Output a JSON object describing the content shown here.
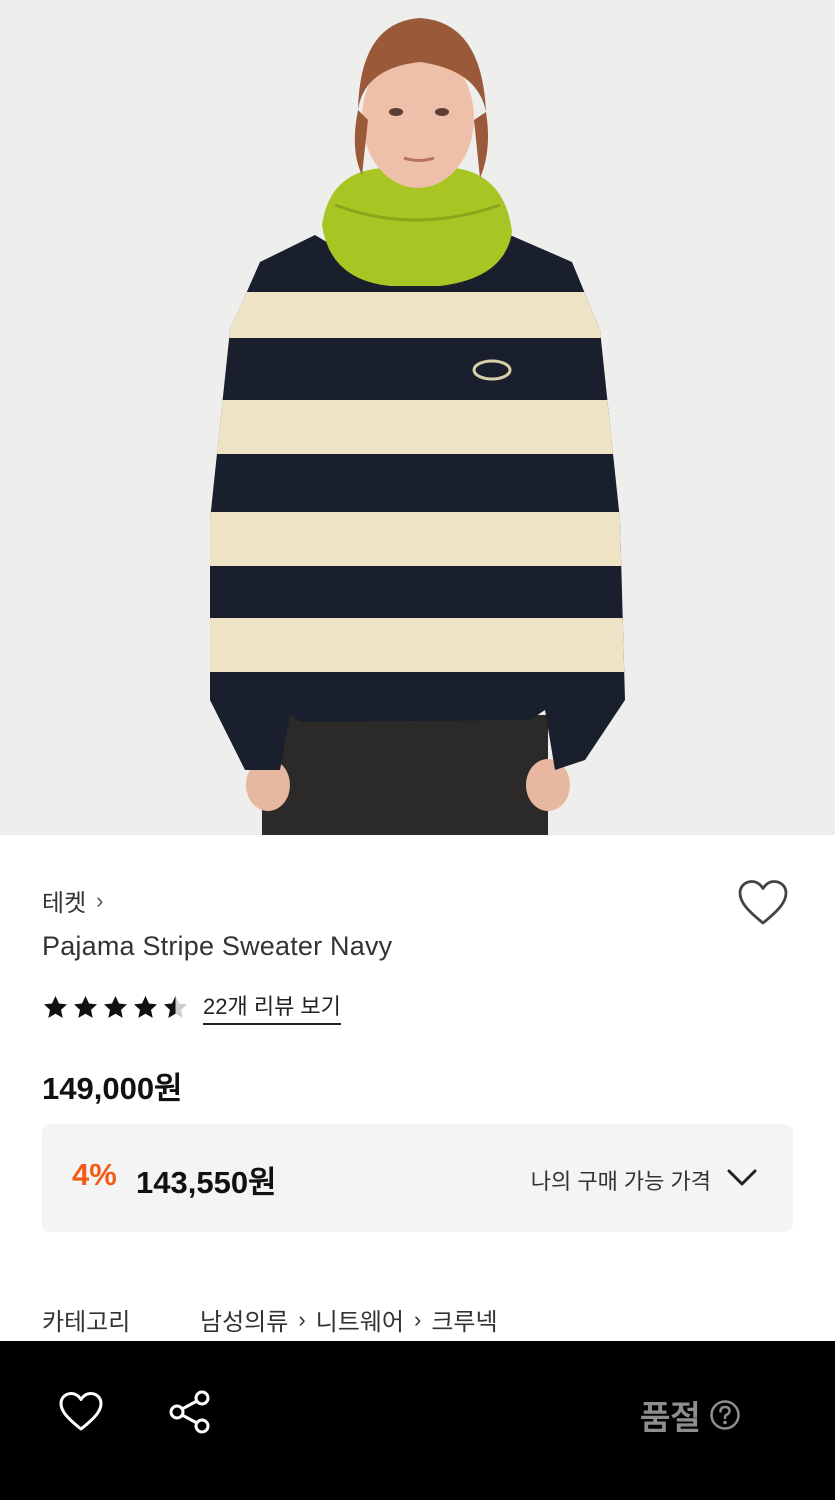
{
  "product": {
    "image_alt": "Model wearing striped sweater with green neck warmer",
    "brand": "테켓",
    "brand_chevron": "›",
    "name": "Pajama Stripe Sweater Navy",
    "rating": 4.5,
    "review_link": "22개 리뷰 보기",
    "price": "149,000원",
    "my_price": {
      "discount": "4%",
      "amount": "143,550원",
      "label": "나의 구매 가능 가격"
    },
    "category": {
      "label": "카테고리",
      "path": [
        "남성의류",
        "니트웨어",
        "크루넥"
      ],
      "separator": "›"
    }
  },
  "bottom_bar": {
    "wishlist_icon": "heart-outline-icon",
    "share_icon": "share-icon",
    "status": "품절",
    "help_icon": "question-circle-icon"
  },
  "colors": {
    "discount": "#f25c17",
    "bottom_bar_bg": "#000000",
    "soldout_text": "#8e8e8e",
    "price_box_bg": "#f4f4f4"
  }
}
